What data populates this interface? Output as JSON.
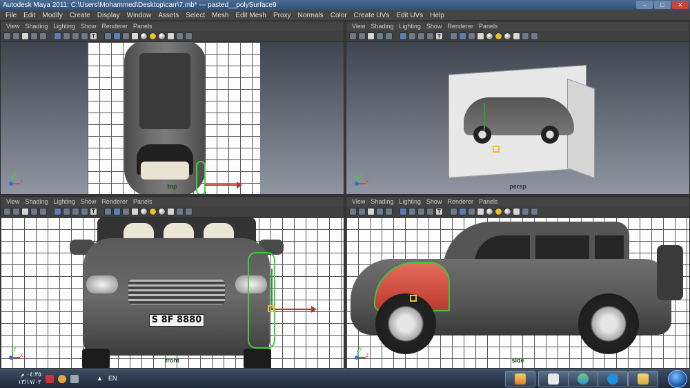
{
  "window": {
    "title": "Autodesk Maya 2011: C:\\Users\\Mohammed\\Desktop\\carr\\7.mb*   ---   pasted__polySurface9",
    "controls": [
      "–",
      "□",
      "✕"
    ]
  },
  "menubar": [
    "File",
    "Edit",
    "Modify",
    "Create",
    "Display",
    "Window",
    "Assets",
    "Select",
    "Mesh",
    "Edit Mesh",
    "Proxy",
    "Normals",
    "Color",
    "Create UVs",
    "Edit UVs",
    "Help"
  ],
  "panel_menu": [
    "View",
    "Shading",
    "Lighting",
    "Show",
    "Renderer",
    "Panels"
  ],
  "viewports": {
    "top": {
      "label": "top",
      "axis_y": "y",
      "axis_x": "x"
    },
    "persp": {
      "label": "persp",
      "axis_y": "y",
      "axis_x": "x"
    },
    "front": {
      "label": "front",
      "axis_y": "y",
      "axis_x": "x",
      "plate": "S 8F 8880"
    },
    "side": {
      "label": "side",
      "axis_y": "y",
      "axis_x": "z"
    }
  },
  "taskbar": {
    "time": "٠٤:٣٥ م",
    "date": "١٣/١٧/٠٢",
    "language": "EN",
    "tray_arrow": "▲",
    "colors": {
      "accent": "#2f4f77",
      "selection": "#3ecf3e",
      "fender": "#f26b5b"
    }
  }
}
